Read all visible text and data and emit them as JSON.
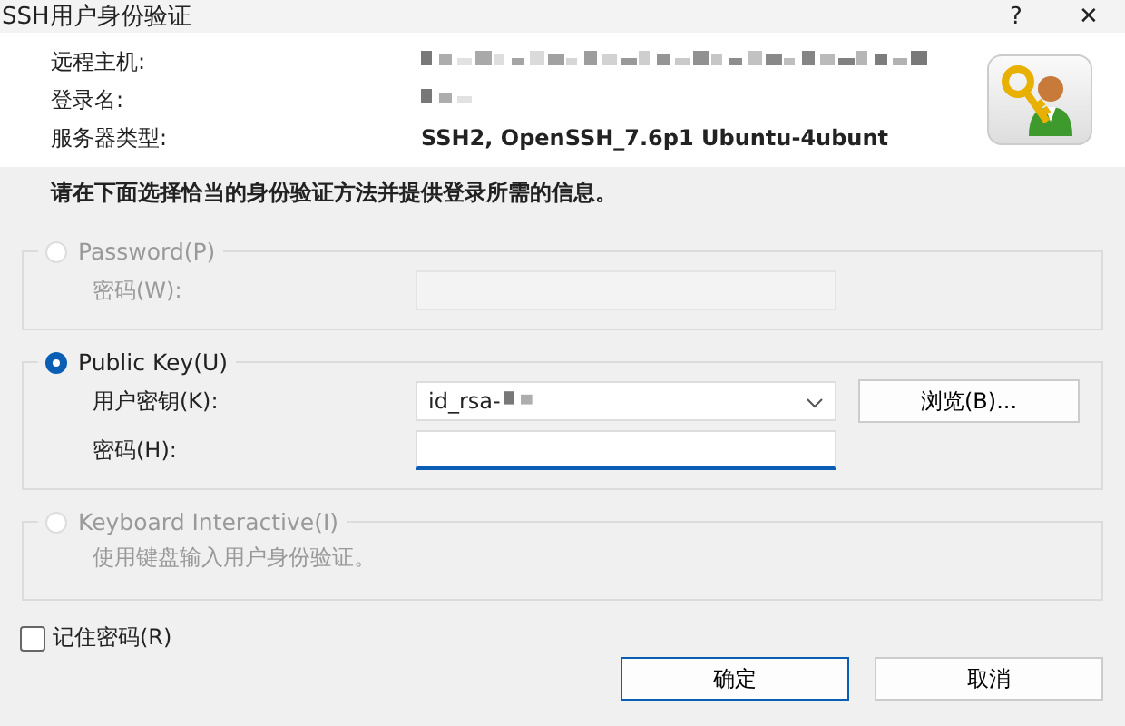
{
  "window": {
    "title": "SSH用户身份验证",
    "help": "?",
    "close": "✕"
  },
  "header": [
    {
      "label": "远程主机:",
      "blurred": true
    },
    {
      "label": "登录名:",
      "blurred": true
    },
    {
      "label": "服务器类型:",
      "blurred": false,
      "value": "SSH2, OpenSSH_7.6p1 Ubuntu-4ubunt"
    }
  ],
  "instruction": "请在下面选择恰当的身份验证方法并提供登录所需的信息。",
  "methods": [
    {
      "label": "Password(P)",
      "selected": false,
      "disabled": true,
      "fields": [
        {
          "label": "密码(W):",
          "kind": "password",
          "focused": false
        }
      ]
    },
    {
      "label": "Public Key(U)",
      "selected": true,
      "disabled": false,
      "fields": [
        {
          "label": "用户密钥(K):",
          "kind": "dropdown",
          "value": "id_rsa-",
          "blurred": true,
          "button": "浏览(B)..."
        },
        {
          "label": "密码(H):",
          "kind": "password",
          "focused": true
        }
      ]
    },
    {
      "label": "Keyboard Interactive(I)",
      "selected": false,
      "disabled": true,
      "note": "使用键盘输入用户身份验证。"
    }
  ],
  "remember": {
    "label": "记住密码(R)",
    "checked": false
  },
  "buttons": [
    {
      "label": "确定",
      "default": true
    },
    {
      "label": "取消",
      "default": false
    }
  ]
}
